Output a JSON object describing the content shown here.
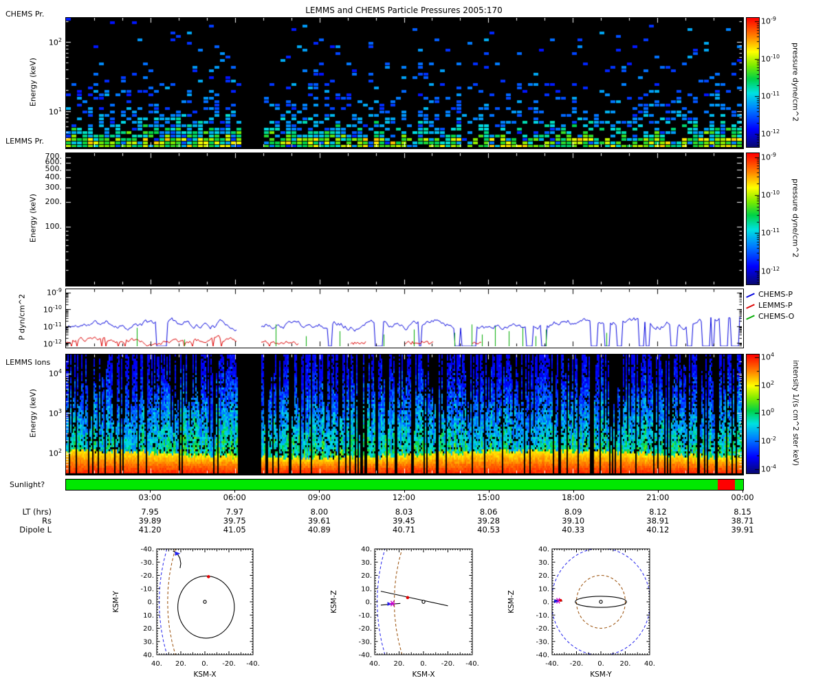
{
  "title": "LEMMS and CHEMS Particle Pressures  2005:170",
  "captions": {
    "chems": "CHEMS Pr.",
    "lemms": "LEMMS Pr.",
    "ions": "LEMMS Ions",
    "sunlight": "Sunlight?"
  },
  "axis_titles": {
    "energy": "Energy (keV)",
    "p3": "P dyn/cm^2"
  },
  "legend": [
    {
      "label": "CHEMS-P",
      "color": "#0000dd"
    },
    {
      "label": "LEMMS-P",
      "color": "#dd0000"
    },
    {
      "label": "CHEMS-O",
      "color": "#00aa00"
    }
  ],
  "chart_data": {
    "type": [
      "heatmap",
      "heatmap",
      "line",
      "heatmap"
    ],
    "time_range_hours": [
      0,
      24
    ],
    "data_gap": [
      0.253,
      0.287
    ],
    "time_axis": {
      "labels": [
        "03:00",
        "06:00",
        "09:00",
        "12:00",
        "15:00",
        "18:00",
        "21:00",
        "00:00"
      ],
      "fracs": [
        0.125,
        0.25,
        0.375,
        0.5,
        0.625,
        0.75,
        0.875,
        1.0
      ]
    },
    "panels": {
      "p1": {
        "label": "CHEMS Pr.",
        "type": "heatmap",
        "ylabel": "Energy (keV)",
        "yscale": {
          "type": "log",
          "min": 3,
          "max": 224
        },
        "yticks": [
          {
            "v": 100,
            "l": "10^2"
          },
          {
            "v": 10,
            "l": "10^1"
          }
        ],
        "seed": 7,
        "description": "sparse scattered CHEMS pressure pixels; density and green/yellow color increase toward low energy; blue specks at high energy; data gap near 06:20-06:50"
      },
      "p2": {
        "label": "LEMMS Pr.",
        "type": "heatmap",
        "ylabel": "Energy (keV)",
        "yscale": {
          "type": "log",
          "min": 20,
          "max": 787
        },
        "yticks": [
          {
            "v": 700,
            "l": "700."
          },
          {
            "v": 600,
            "l": "600."
          },
          {
            "v": 500,
            "l": "500."
          },
          {
            "v": 400,
            "l": "400."
          },
          {
            "v": 300,
            "l": "300."
          },
          {
            "v": 200,
            "l": "200."
          },
          {
            "v": 100,
            "l": "100."
          }
        ],
        "empty": true,
        "description": "LEMMS pressure spectrogram, no data above threshold (all black)"
      },
      "p3": {
        "type": "line",
        "ylabel": "P dyn/cm^2",
        "yscale": {
          "type": "log",
          "min": 6.3e-13,
          "max": 1.6e-09
        },
        "yticks": [
          {
            "v": 1e-09,
            "l": "10^-9"
          },
          {
            "v": 1e-10,
            "l": "10^-10"
          },
          {
            "v": 1e-11,
            "l": "10^-11"
          },
          {
            "v": 1e-12,
            "l": "10^-12"
          }
        ],
        "series_levels_log10": {
          "CHEMS-P": -10.85,
          "LEMMS-P": -11.9,
          "CHEMS-O": -12.2
        },
        "red_windows": [
          [
            0.42,
            0.445
          ],
          [
            0.5,
            0.545
          ],
          [
            0.6,
            0.615
          ]
        ],
        "green_spikes": [
          [
            0.105,
            -11.1
          ],
          [
            0.175,
            -11.8
          ],
          [
            0.31,
            -10.9
          ],
          [
            0.355,
            -11.6
          ],
          [
            0.405,
            -11.3
          ],
          [
            0.47,
            -11.5
          ],
          [
            0.515,
            -11.2
          ],
          [
            0.575,
            -11.4
          ],
          [
            0.6,
            -10.9
          ],
          [
            0.615,
            -11.5
          ],
          [
            0.635,
            -11.0
          ],
          [
            0.655,
            -11.3
          ],
          [
            0.675,
            -11.1
          ],
          [
            0.695,
            -11.6
          ],
          [
            0.71,
            -11.2
          ],
          [
            0.8,
            -11.4
          ]
        ],
        "description": "CHEMS-P blue line fluctuating near 1e-11 with dropouts to bottom in right half; LEMMS-P red near 1e-12 in first third; CHEMS-O green vertical spikes"
      },
      "p4": {
        "label": "LEMMS Ions",
        "type": "heatmap",
        "ylabel": "Energy (keV)",
        "yscale": {
          "type": "log",
          "min": 30,
          "max": 30000
        },
        "yticks": [
          {
            "v": 10000,
            "l": "10^4"
          },
          {
            "v": 1000,
            "l": "10^3"
          },
          {
            "v": 100,
            "l": "10^2"
          }
        ],
        "seed": 13,
        "description": "dense vertical intensity striping; continuous bright yellow-orange band at lowest energies; blue/green stripes to high energy; black gap near 06:20-06:50"
      }
    },
    "colorbars": {
      "pressure": {
        "title": "pressure dyne/cm^2",
        "log_range": [
          -12.35,
          -8.9
        ],
        "ticks": [
          {
            "lv": -9,
            "l": "10^-9"
          },
          {
            "lv": -10,
            "l": "10^-10"
          },
          {
            "lv": -11,
            "l": "10^-11"
          },
          {
            "lv": -12,
            "l": "10^-12"
          }
        ]
      },
      "intensity": {
        "title": "intensity 1/(s cm^2 ster keV)",
        "log_range": [
          -4.3,
          4.2
        ],
        "ticks": [
          {
            "lv": 4,
            "l": "10^4"
          },
          {
            "lv": 2,
            "l": "10^2"
          },
          {
            "lv": 0,
            "l": "10^0"
          },
          {
            "lv": -2,
            "l": "10^-2"
          },
          {
            "lv": -4,
            "l": "10^-4"
          }
        ]
      }
    },
    "sunlight": {
      "label": "Sunlight?",
      "segments": [
        {
          "from": 0,
          "to": 0.962,
          "color": "#00e800"
        },
        {
          "from": 0.962,
          "to": 0.988,
          "color": "#ff0000"
        },
        {
          "from": 0.988,
          "to": 1,
          "color": "#00e800"
        }
      ]
    },
    "ephemeris": {
      "rows": [
        {
          "label": "LT (hrs)",
          "values": [
            "7.95",
            "7.97",
            "8.00",
            "8.03",
            "8.06",
            "8.09",
            "8.12",
            "8.15"
          ]
        },
        {
          "label": "Rs",
          "values": [
            "39.89",
            "39.75",
            "39.61",
            "39.45",
            "39.28",
            "39.10",
            "38.91",
            "38.71"
          ]
        },
        {
          "label": "Dipole L",
          "values": [
            "41.20",
            "41.05",
            "40.89",
            "40.71",
            "40.53",
            "40.33",
            "40.12",
            "39.91"
          ]
        }
      ]
    },
    "orbit_plots": [
      {
        "name": "xy",
        "xlabel": "KSM-X",
        "ylabel": "KSM-Y",
        "x_range": [
          40,
          -40
        ],
        "y_range": [
          -40,
          40
        ],
        "x_tick_vals": [
          40,
          20,
          0,
          -20,
          -40
        ],
        "x_tick_labels": [
          "40.",
          "20.",
          "0.",
          "-20.",
          "-40."
        ],
        "y_tick_vals": [
          -40,
          -30,
          -20,
          -10,
          0,
          10,
          20,
          30,
          40
        ],
        "y_tick_labels": [
          "-40.",
          "-30.",
          "-20.",
          "-10.",
          "0.",
          "10.",
          "20.",
          "30.",
          "40."
        ],
        "shapes": [
          {
            "type": "polyline",
            "color": "#3333ee",
            "dash": "4,3",
            "points": [
              [
                31.6,
                -40
              ],
              [
                34.4,
                -30
              ],
              [
                36.4,
                -20
              ],
              [
                37.6,
                -10
              ],
              [
                38,
                0
              ],
              [
                37.6,
                10
              ],
              [
                36.4,
                20
              ],
              [
                34.4,
                30
              ],
              [
                31.6,
                40
              ]
            ]
          },
          {
            "type": "polyline",
            "color": "#a05a18",
            "dash": "4,3",
            "points": [
              [
                24.6,
                -40
              ],
              [
                27.4,
                -30
              ],
              [
                29.4,
                -20
              ],
              [
                30.6,
                -10
              ],
              [
                31,
                0
              ],
              [
                30.6,
                10
              ],
              [
                29.4,
                20
              ],
              [
                27.4,
                30
              ],
              [
                24.6,
                40
              ]
            ]
          },
          {
            "type": "circle",
            "color": "#000000",
            "cx": -1,
            "cy": 4,
            "r": 23.5
          },
          {
            "type": "circle",
            "color": "#000000",
            "cx": 0,
            "cy": 0,
            "r": 1.2,
            "fill": "#ffffff"
          },
          {
            "type": "polyline",
            "color": "#000000",
            "points": [
              [
                26.5,
                -38.5
              ],
              [
                23,
                -36.5
              ],
              [
                20.8,
                -33
              ],
              [
                20,
                -29
              ],
              [
                20.6,
                -25.5
              ]
            ]
          },
          {
            "type": "tri",
            "color": "#2222ee",
            "x": 23,
            "y": -36.5,
            "size": 4.5
          },
          {
            "type": "dot",
            "color": "#e00000",
            "x": -3,
            "y": -19,
            "r": 2.3
          }
        ]
      },
      {
        "name": "xz",
        "xlabel": "KSM-X",
        "ylabel": "KSM-Z",
        "x_range": [
          40,
          -40
        ],
        "y_range": [
          40,
          -40
        ],
        "x_tick_vals": [
          40,
          20,
          0,
          -20,
          -40
        ],
        "x_tick_labels": [
          "40.",
          "20.",
          "0.",
          "-20.",
          "-40."
        ],
        "y_tick_vals": [
          40,
          30,
          20,
          10,
          0,
          -10,
          -20,
          -30,
          -40
        ],
        "y_tick_labels": [
          "40.",
          "30.",
          "20.",
          "10.",
          "0.",
          "-10.",
          "-20.",
          "-30.",
          "-40."
        ],
        "shapes": [
          {
            "type": "polyline",
            "color": "#3333ee",
            "dash": "4,3",
            "points": [
              [
                31.6,
                -40
              ],
              [
                34.4,
                -30
              ],
              [
                36.4,
                -20
              ],
              [
                37.6,
                -10
              ],
              [
                38,
                0
              ],
              [
                37.6,
                10
              ],
              [
                36.4,
                20
              ],
              [
                34.4,
                30
              ],
              [
                31.6,
                40
              ]
            ]
          },
          {
            "type": "polyline",
            "color": "#a05a18",
            "dash": "4,3",
            "points": [
              [
                17.6,
                -40
              ],
              [
                20.4,
                -30
              ],
              [
                22.4,
                -20
              ],
              [
                23.6,
                -10
              ],
              [
                24,
                0
              ],
              [
                23.6,
                10
              ],
              [
                22.4,
                20
              ],
              [
                20.4,
                30
              ],
              [
                17.6,
                40
              ]
            ]
          },
          {
            "type": "polyline",
            "color": "#000000",
            "points": [
              [
                35,
                8
              ],
              [
                -20,
                -3
              ]
            ]
          },
          {
            "type": "polyline",
            "color": "#000000",
            "points": [
              [
                35,
                -2.5
              ],
              [
                19,
                -1.2
              ]
            ]
          },
          {
            "type": "circle",
            "color": "#000000",
            "cx": 0,
            "cy": 0,
            "r": 1.2,
            "fill": "#ffffff"
          },
          {
            "type": "tri",
            "color": "#2222ee",
            "x": 28,
            "y": -1.6,
            "size": 4
          },
          {
            "type": "star",
            "color": "#cc00cc",
            "x": 25.5,
            "y": -1.3,
            "size": 4.5
          },
          {
            "type": "dot",
            "color": "#e00000",
            "x": 13,
            "y": 3.2,
            "r": 2.3
          }
        ]
      },
      {
        "name": "yz",
        "xlabel": "KSM-Y",
        "ylabel": "KSM-Z",
        "x_range": [
          -40,
          40
        ],
        "y_range": [
          40,
          -40
        ],
        "x_tick_vals": [
          -40,
          -20,
          0,
          20,
          40
        ],
        "x_tick_labels": [
          "-40.",
          "-20.",
          "0.",
          "20.",
          "40."
        ],
        "y_tick_vals": [
          40,
          30,
          20,
          10,
          0,
          -10,
          -20,
          -30,
          -40
        ],
        "y_tick_labels": [
          "40.",
          "30.",
          "20.",
          "10.",
          "0.",
          "-10.",
          "-20.",
          "-30.",
          "-40."
        ],
        "shapes": [
          {
            "type": "circle",
            "color": "#3333ee",
            "dash": "4,3",
            "cx": 0,
            "cy": 0,
            "r": 40.5
          },
          {
            "type": "circle",
            "color": "#a05a18",
            "dash": "4,3",
            "cx": 0,
            "cy": 0,
            "r": 20
          },
          {
            "type": "ellipse",
            "color": "#000000",
            "cx": 0,
            "cy": 0,
            "rx": 21,
            "ry": 4.2
          },
          {
            "type": "circle",
            "color": "#000000",
            "cx": 0,
            "cy": 0,
            "r": 1.2,
            "fill": "#ffffff"
          },
          {
            "type": "polyline",
            "color": "#000000",
            "points": [
              [
                -38,
                1.5
              ],
              [
                -31.5,
                0.5
              ]
            ]
          },
          {
            "type": "star",
            "color": "#cc00cc",
            "x": -35,
            "y": 0.8,
            "size": 4.5
          },
          {
            "type": "tri",
            "color": "#2222ee",
            "x": -36.8,
            "y": 0.4,
            "size": 4
          },
          {
            "type": "dot",
            "color": "#e00000",
            "x": -33,
            "y": 1.1,
            "r": 2
          }
        ]
      }
    ]
  }
}
